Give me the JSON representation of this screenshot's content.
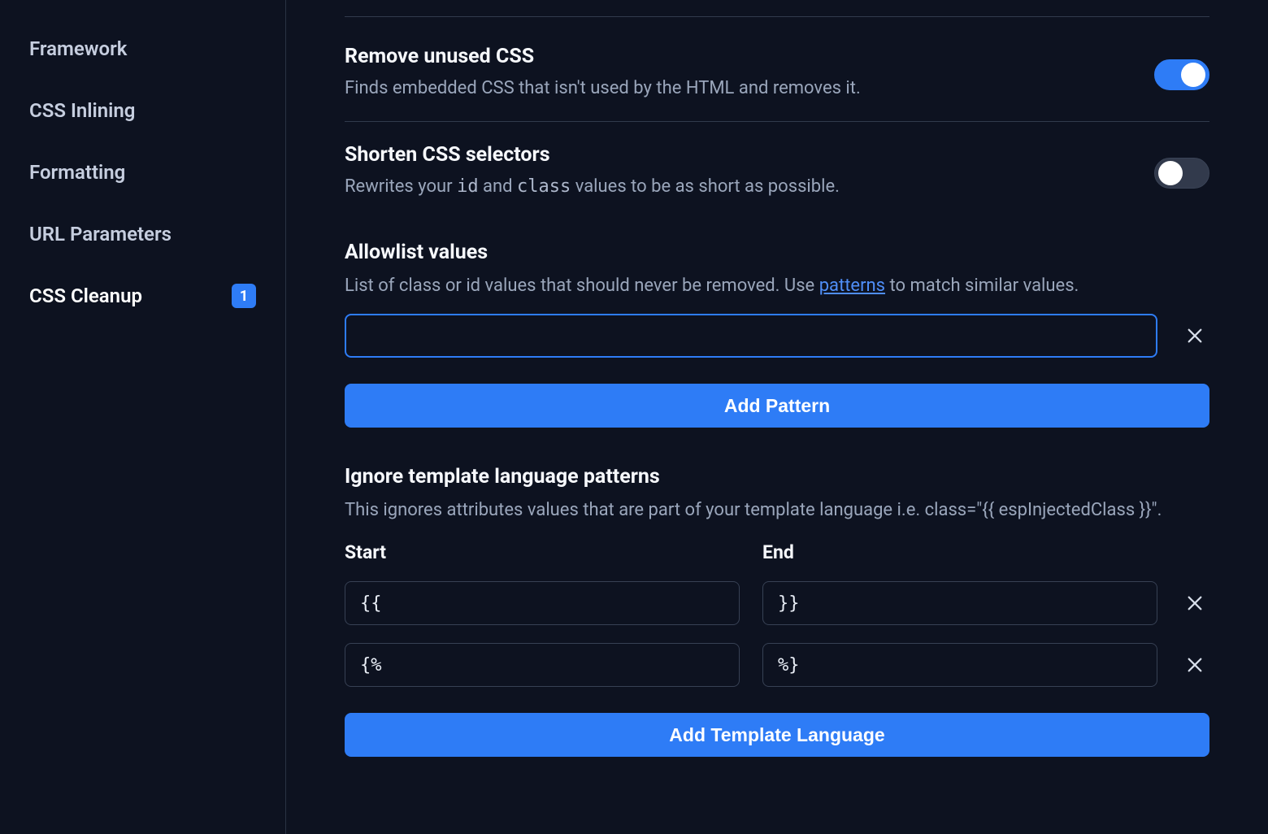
{
  "sidebar": {
    "items": [
      {
        "label": "Framework",
        "active": false,
        "badge": null
      },
      {
        "label": "CSS Inlining",
        "active": false,
        "badge": null
      },
      {
        "label": "Formatting",
        "active": false,
        "badge": null
      },
      {
        "label": "URL Parameters",
        "active": false,
        "badge": null
      },
      {
        "label": "CSS Cleanup",
        "active": true,
        "badge": "1"
      }
    ]
  },
  "settings": {
    "removeUnused": {
      "title": "Remove unused CSS",
      "desc": "Finds embedded CSS that isn't used by the HTML and removes it.",
      "enabled": true
    },
    "shortenSelectors": {
      "title": "Shorten CSS selectors",
      "desc_pre": "Rewrites your ",
      "code1": "id",
      "mid": " and ",
      "code2": "class",
      "desc_post": " values to be as short as possible.",
      "enabled": false
    }
  },
  "allowlist": {
    "title": "Allowlist values",
    "desc_pre": "List of class or id values that should never be removed. Use ",
    "link": "patterns",
    "desc_post": " to match similar values.",
    "value": "",
    "addButton": "Add Pattern"
  },
  "templatePatterns": {
    "title": "Ignore template language patterns",
    "desc": "This ignores attributes values that are part of your template language i.e. class=\"{{ espInjectedClass }}\".",
    "startLabel": "Start",
    "endLabel": "End",
    "rows": [
      {
        "start": "{{",
        "end": "}}"
      },
      {
        "start": "{%",
        "end": "%}"
      }
    ],
    "addButton": "Add Template Language"
  }
}
